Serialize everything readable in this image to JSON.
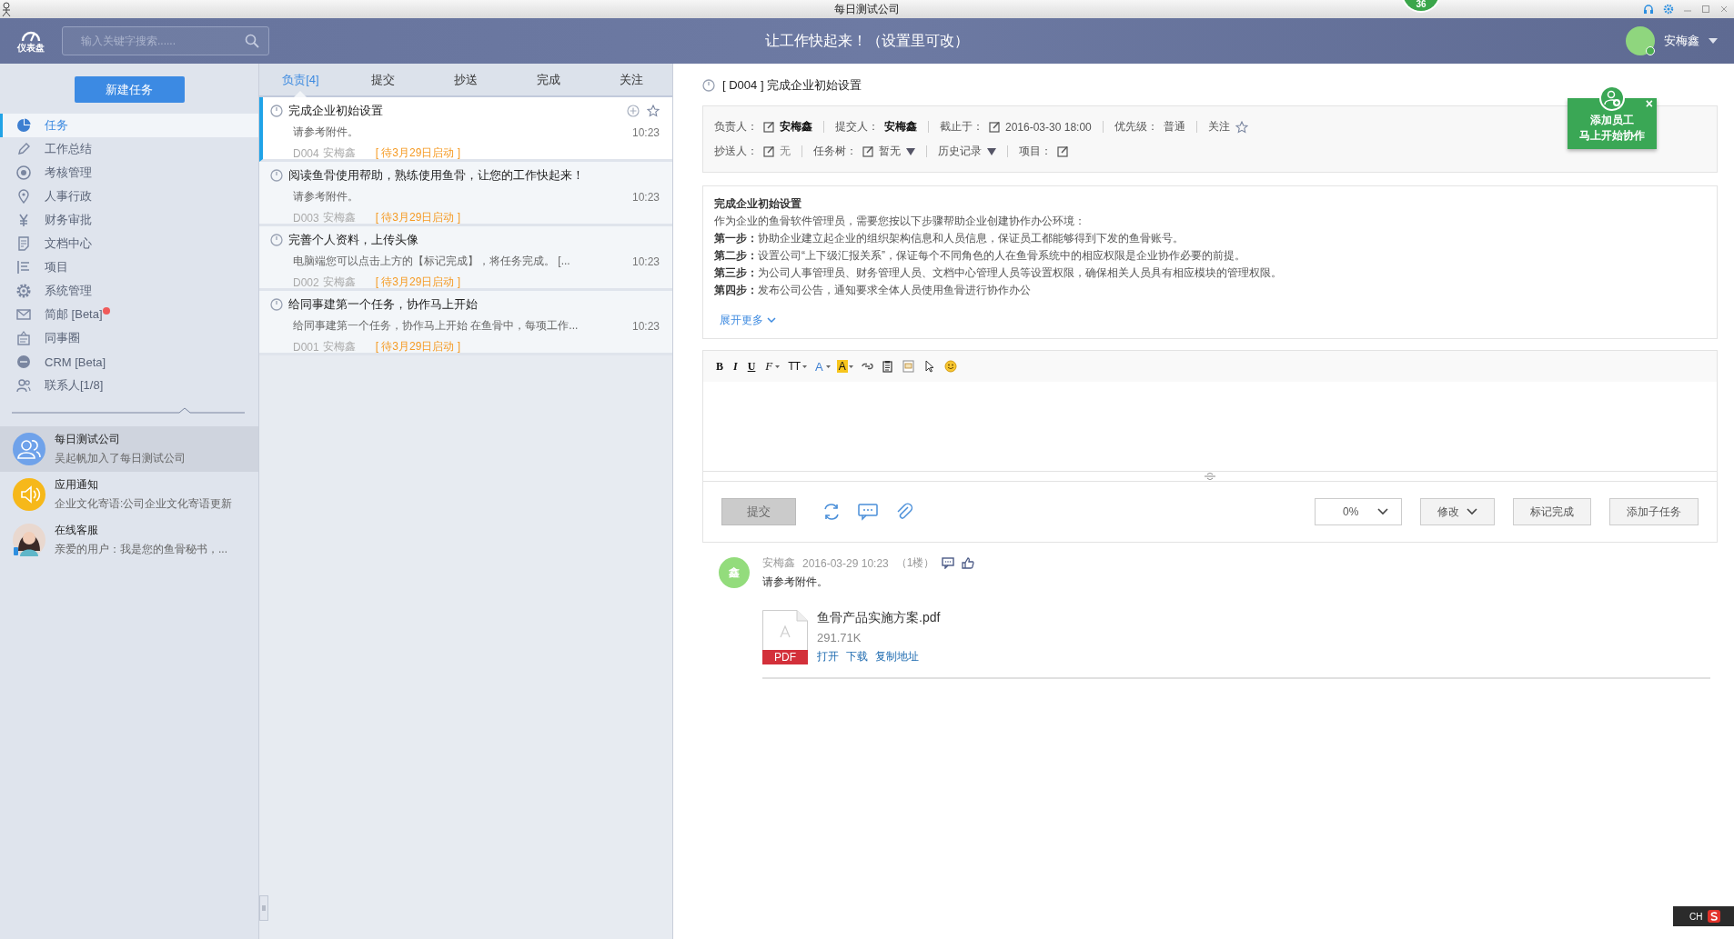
{
  "window": {
    "title": "每日测试公司",
    "badge": "36"
  },
  "header": {
    "logo_label": "仪表盘",
    "search": {
      "placeholder": "输入关键字搜索......"
    },
    "slogan": "让工作快起来！（设置里可改）",
    "user": "安梅鑫"
  },
  "sidebar": {
    "new_button": "新建任务",
    "items": [
      {
        "label": "任务",
        "selected": true,
        "unread": false
      },
      {
        "label": "工作总结",
        "selected": false,
        "unread": false
      },
      {
        "label": "考核管理",
        "selected": false,
        "unread": false
      },
      {
        "label": "人事行政",
        "selected": false,
        "unread": false
      },
      {
        "label": "财务审批",
        "selected": false,
        "unread": false
      },
      {
        "label": "文档中心",
        "selected": false,
        "unread": false
      },
      {
        "label": "项目",
        "selected": false,
        "unread": false
      },
      {
        "label": "系统管理",
        "selected": false,
        "unread": false
      },
      {
        "label": "简邮 [Beta]",
        "selected": false,
        "unread": true
      },
      {
        "label": "同事圈",
        "selected": false,
        "unread": false
      },
      {
        "label": "CRM [Beta]",
        "selected": false,
        "unread": false
      },
      {
        "label": "联系人[1/8]",
        "selected": false,
        "unread": false
      }
    ],
    "chats": [
      {
        "name": "每日测试公司",
        "preview": "吴起帆加入了每日测试公司",
        "selected": true
      },
      {
        "name": "应用通知",
        "preview": "企业文化寄语:公司企业文化寄语更新",
        "selected": false
      },
      {
        "name": "在线客服",
        "preview": "亲爱的用户：我是您的鱼骨秘书，...",
        "selected": false
      }
    ]
  },
  "task_list": {
    "tabs": [
      {
        "label": "负责[4]",
        "selected": true
      },
      {
        "label": "提交",
        "selected": false
      },
      {
        "label": "抄送",
        "selected": false
      },
      {
        "label": "完成",
        "selected": false
      },
      {
        "label": "关注",
        "selected": false
      }
    ],
    "tasks": [
      {
        "title": "完成企业初始设置",
        "summary": "请参考附件。",
        "code": "D004",
        "owner": "安梅鑫",
        "status": "[ 待3月29日启动 ]",
        "time": "10:23",
        "selected": true
      },
      {
        "title": "阅读鱼骨使用帮助，熟练使用鱼骨，让您的工作快起来！",
        "summary": "请参考附件。",
        "code": "D003",
        "owner": "安梅鑫",
        "status": "[ 待3月29日启动 ]",
        "time": "10:23",
        "selected": false
      },
      {
        "title": "完善个人资料，上传头像",
        "summary": "电脑端您可以点击上方的【标记完成】，将任务完成。 [...",
        "code": "D002",
        "owner": "安梅鑫",
        "status": "[ 待3月29日启动 ]",
        "time": "10:23",
        "selected": false
      },
      {
        "title": "给同事建第一个任务，协作马上开始",
        "summary": "给同事建第一个任务，协作马上开始 在鱼骨中，每项工作...",
        "code": "D001",
        "owner": "安梅鑫",
        "status": "[ 待3月29日启动 ]",
        "time": "10:23",
        "selected": false
      }
    ]
  },
  "detail": {
    "title": "[ D004 ] 完成企业初始设置",
    "meta": [
      [
        {
          "kind": "field",
          "label": "负责人：",
          "editable": true,
          "value": "安梅鑫",
          "strong": true,
          "dropdown": false
        },
        {
          "kind": "field",
          "label": "提交人：",
          "editable": false,
          "value": "安梅鑫",
          "strong": true,
          "dropdown": false
        },
        {
          "kind": "field",
          "label": "截止于：",
          "editable": true,
          "value": "2016-03-30 18:00",
          "strong": false,
          "dropdown": false
        },
        {
          "kind": "field",
          "label": "优先级：",
          "editable": false,
          "value": "普通",
          "strong": false,
          "dropdown": false
        },
        {
          "kind": "follow",
          "label": "关注",
          "followed": false
        }
      ],
      [
        {
          "kind": "field",
          "label": "抄送人：",
          "editable": true,
          "value": "无",
          "strong": false,
          "dropdown": false
        },
        {
          "kind": "field",
          "label": "任务树：",
          "editable": true,
          "value": "暂无",
          "strong": false,
          "dropdown": true
        },
        {
          "kind": "field",
          "label": "历史记录",
          "editable": false,
          "dropdown": true
        },
        {
          "kind": "field",
          "label": "项目：",
          "editable": true,
          "dropdown": false
        }
      ]
    ],
    "description": {
      "heading": "完成企业初始设置",
      "lines": [
        "作为企业的鱼骨软件管理员，需要您按以下步骤帮助企业创建协作办公环境：",
        "**第一步：**协助企业建立起企业的组织架构信息和人员信息，保证员工都能够得到下发的鱼骨账号。",
        "**第二步：**设置公司“上下级汇报关系”，保证每个不同角色的人在鱼骨系统中的相应权限是企业协作必要的前提。",
        "**第三步：**为公司人事管理员、财务管理人员、文档中心管理人员等设置权限，确保相关人员具有相应模块的管理权限。",
        "**第四步：**发布公司公告，通知要求全体人员使用鱼骨进行协作办公"
      ],
      "expand": "展开更多"
    },
    "editor": {
      "toolbar": [
        {
          "kind": "bold",
          "label": "B"
        },
        {
          "kind": "italic",
          "label": "I"
        },
        {
          "kind": "underline",
          "label": "U"
        },
        {
          "kind": "font",
          "label": "F"
        },
        {
          "kind": "size",
          "label": "TT"
        },
        {
          "kind": "color",
          "label": "A"
        },
        {
          "kind": "highlight",
          "label": "A"
        },
        {
          "kind": "link"
        },
        {
          "kind": "paste"
        },
        {
          "kind": "code"
        },
        {
          "kind": "cursor"
        },
        {
          "kind": "emoji"
        }
      ],
      "submit": "提交",
      "progress": "0%",
      "buttons": [
        {
          "label": "修改",
          "dropdown": true
        },
        {
          "label": "标记完成",
          "dropdown": false
        },
        {
          "label": "添加子任务",
          "dropdown": false
        }
      ]
    },
    "comments": [
      {
        "avatar": "鑫",
        "author": "安梅鑫",
        "time": "2016-03-29 10:23",
        "floor": "（1楼）",
        "text": "请参考附件。",
        "attachment": {
          "type_label": "PDF",
          "name": "鱼骨产品实施方案.pdf",
          "size": "291.71K",
          "links": [
            "打开",
            "下载",
            "复制地址"
          ]
        }
      }
    ]
  },
  "popup": {
    "lines": [
      "添加员工",
      "马上开始协作"
    ],
    "close": "×"
  },
  "tray": {
    "label": "CH"
  }
}
